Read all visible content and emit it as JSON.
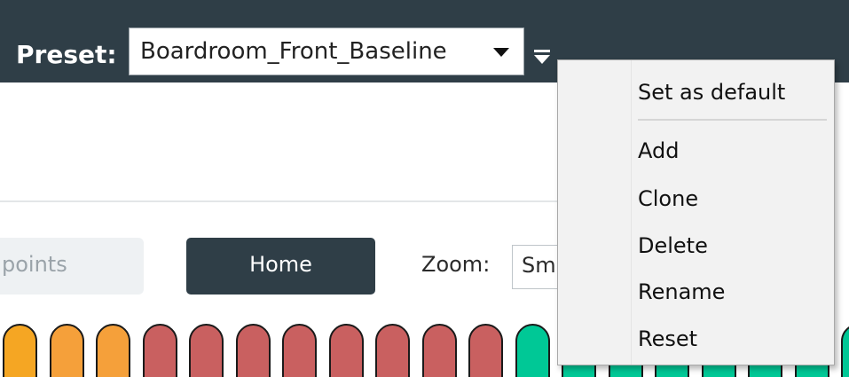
{
  "header": {
    "preset_label": "Preset:",
    "preset_value": "Boardroom_Front_Baseline"
  },
  "toolbar": {
    "viewpoints_label": "points",
    "home_label": "Home",
    "zoom_label": "Zoom:",
    "zoom_value": "Sm"
  },
  "context_menu": {
    "items": [
      "Set as default",
      "Add",
      "Clone",
      "Delete",
      "Rename",
      "Reset"
    ]
  },
  "pill_colors": [
    "#f5a623",
    "#f5a03a",
    "#f5a03a",
    "#c96060",
    "#c96060",
    "#c96060",
    "#c96060",
    "#c96060",
    "#c96060",
    "#c96060",
    "#c96060",
    "#00c896",
    "#00c896",
    "#00c896",
    "#00c896",
    "#00c896",
    "#00c896",
    "#00c896",
    "#00c896"
  ]
}
